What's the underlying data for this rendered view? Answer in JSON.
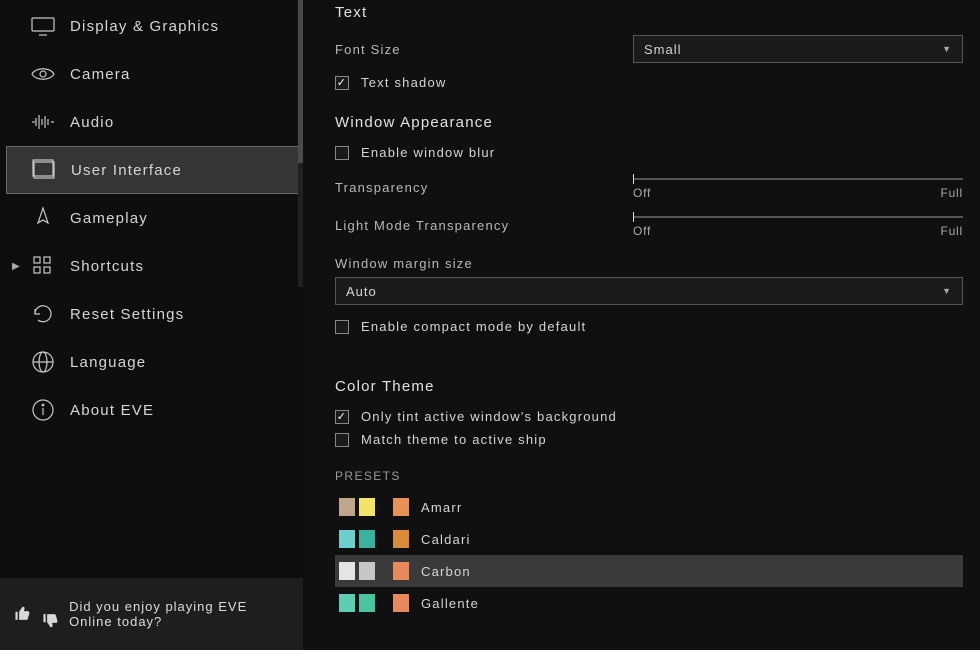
{
  "sidebar": {
    "items": [
      {
        "label": "Display & Graphics",
        "active": false
      },
      {
        "label": "Camera",
        "active": false
      },
      {
        "label": "Audio",
        "active": false
      },
      {
        "label": "User Interface",
        "active": true
      },
      {
        "label": "Gameplay",
        "active": false
      },
      {
        "label": "Shortcuts",
        "active": false,
        "expandable": true
      },
      {
        "label": "Reset Settings",
        "active": false
      },
      {
        "label": "Language",
        "active": false
      },
      {
        "label": "About EVE",
        "active": false
      }
    ]
  },
  "feedback": {
    "prompt": "Did you enjoy playing EVE Online today?"
  },
  "text_section": {
    "heading": "Text",
    "font_size_label": "Font Size",
    "font_size_value": "Small",
    "text_shadow_label": "Text shadow",
    "text_shadow_checked": true
  },
  "window_section": {
    "heading": "Window Appearance",
    "enable_blur_label": "Enable window blur",
    "enable_blur_checked": false,
    "transparency_label": "Transparency",
    "light_transparency_label": "Light Mode Transparency",
    "slider_off": "Off",
    "slider_full": "Full",
    "margin_label": "Window margin size",
    "margin_value": "Auto",
    "compact_label": "Enable compact mode by default",
    "compact_checked": false
  },
  "color_section": {
    "heading": "Color Theme",
    "only_tint_label": "Only tint active window's background",
    "only_tint_checked": true,
    "match_ship_label": "Match theme to active ship",
    "match_ship_checked": false,
    "presets_heading": "PRESETS",
    "presets": [
      {
        "name": "Amarr",
        "c1": "#bda68a",
        "c2": "#f2e46a",
        "c3": "#e89157",
        "active": false
      },
      {
        "name": "Caldari",
        "c1": "#6ccfcf",
        "c2": "#3bb2a0",
        "c3": "#d98b3a",
        "active": false
      },
      {
        "name": "Carbon",
        "c1": "#e5e5e5",
        "c2": "#c7c7c7",
        "c3": "#e8895c",
        "active": true
      },
      {
        "name": "Gallente",
        "c1": "#5ecdb1",
        "c2": "#49c4a1",
        "c3": "#e8895c",
        "active": false
      }
    ]
  }
}
